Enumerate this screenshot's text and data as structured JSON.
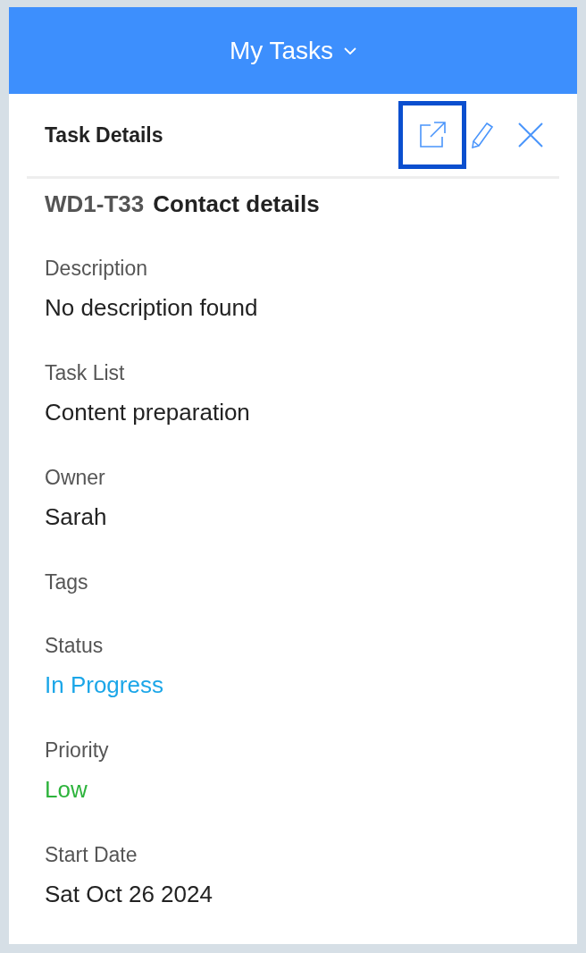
{
  "header": {
    "title": "My Tasks"
  },
  "panel": {
    "title": "Task Details",
    "actions": [
      {
        "kind": "open",
        "highlighted": true
      },
      {
        "kind": "edit",
        "highlighted": false
      },
      {
        "kind": "close",
        "highlighted": false
      }
    ]
  },
  "task": {
    "id": "WD1-T33",
    "name": "Contact details"
  },
  "fields": [
    {
      "label": "Description",
      "value": "No description found"
    },
    {
      "label": "Task List",
      "value": "Content preparation"
    },
    {
      "label": "Owner",
      "value": "Sarah"
    },
    {
      "label": "Tags"
    },
    {
      "label": "Status",
      "value": "In Progress",
      "color": "#1ba6e8"
    },
    {
      "label": "Priority",
      "value": "Low",
      "color": "#2db33c"
    },
    {
      "label": "Start Date",
      "value": "Sat Oct 26 2024"
    }
  ]
}
